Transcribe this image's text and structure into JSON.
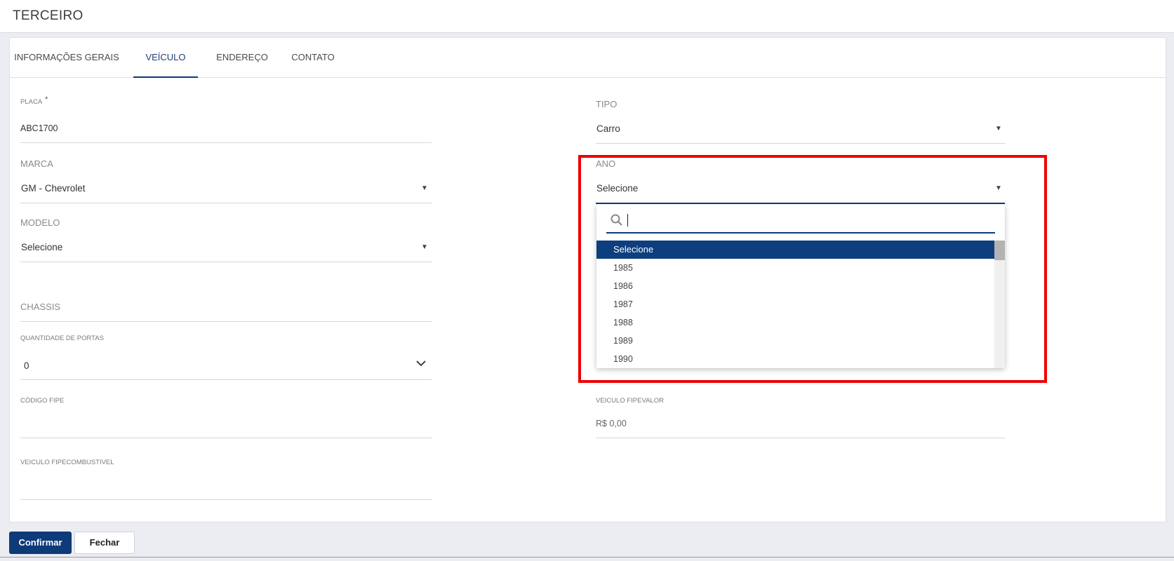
{
  "header": {
    "title": "TERCEIRO"
  },
  "tabs": [
    {
      "label": "INFORMAÇÕES GERAIS",
      "active": false
    },
    {
      "label": "VEÍCULO",
      "active": true
    },
    {
      "label": "ENDEREÇO",
      "active": false
    },
    {
      "label": "CONTATO",
      "active": false
    }
  ],
  "form": {
    "placa": {
      "label": "PLACA",
      "required_mark": "*",
      "value": "ABC1700"
    },
    "tipo": {
      "label": "TIPO",
      "value": "Carro"
    },
    "marca": {
      "label": "MARCA",
      "value": "GM - Chevrolet"
    },
    "ano": {
      "label": "ANO",
      "value": "Selecione"
    },
    "modelo": {
      "label": "MODELO",
      "value": "Selecione"
    },
    "chassis": {
      "label": "CHASSIS",
      "value": ""
    },
    "quantidade_portas": {
      "label": "QUANTIDADE DE PORTAS",
      "value": "0"
    },
    "codigo_fipe": {
      "label": "CÓDIGO FIPE",
      "value": ""
    },
    "veiculo_fipevalor": {
      "label": "VEICULO FIPEVALOR",
      "value": "R$ 0,00"
    },
    "veiculo_fipecombustivel": {
      "label": "VEICULO FIPECOMBUSTIVEL",
      "value": ""
    }
  },
  "ano_dropdown": {
    "search_value": "",
    "options": [
      "Selecione",
      "1985",
      "1986",
      "1987",
      "1988",
      "1989",
      "1990"
    ],
    "selected_index": 0
  },
  "footer": {
    "confirm_label": "Confirmar",
    "close_label": "Fechar"
  },
  "colors": {
    "accent": "#0d3a78",
    "highlight_frame": "#ee0000"
  }
}
